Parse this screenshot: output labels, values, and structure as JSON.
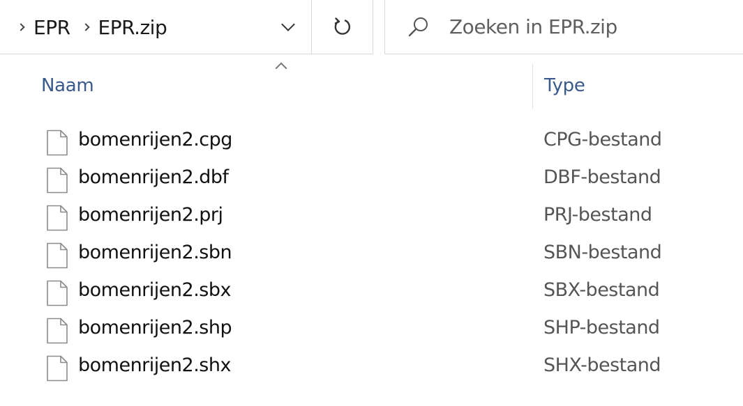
{
  "breadcrumb": {
    "items": [
      "EPR",
      "EPR.zip"
    ]
  },
  "search": {
    "placeholder": "Zoeken in EPR.zip"
  },
  "columns": {
    "name": "Naam",
    "type": "Type",
    "sorted_by": "name",
    "sort_direction": "ascending"
  },
  "files": [
    {
      "name": "bomenrijen2.cpg",
      "type": "CPG-bestand"
    },
    {
      "name": "bomenrijen2.dbf",
      "type": "DBF-bestand"
    },
    {
      "name": "bomenrijen2.prj",
      "type": "PRJ-bestand"
    },
    {
      "name": "bomenrijen2.sbn",
      "type": "SBN-bestand"
    },
    {
      "name": "bomenrijen2.sbx",
      "type": "SBX-bestand"
    },
    {
      "name": "bomenrijen2.shp",
      "type": "SHP-bestand"
    },
    {
      "name": "bomenrijen2.shx",
      "type": "SHX-bestand"
    }
  ],
  "icons": {
    "breadcrumb_separator": "chevron-right-icon",
    "history": "chevron-down-icon",
    "refresh": "refresh-icon",
    "search": "search-icon",
    "sort": "sort-ascending-icon",
    "file": "file-icon"
  }
}
